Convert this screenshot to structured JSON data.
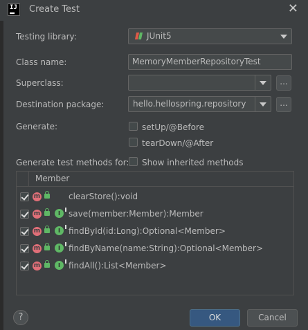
{
  "window": {
    "title": "Create Test",
    "app_icon_text": "IJ"
  },
  "form": {
    "testing_library": {
      "label": "Testing library:",
      "value": "JUnit5",
      "icon": "junit-icon"
    },
    "class_name": {
      "label": "Class name:",
      "value": "MemoryMemberRepositoryTest"
    },
    "superclass": {
      "label": "Superclass:",
      "value": ""
    },
    "destination_package": {
      "label": "Destination package:",
      "value": "hello.hellospring.repository"
    },
    "browse_label": "...",
    "generate": {
      "label": "Generate:",
      "options": [
        {
          "label": "setUp/@Before",
          "checked": false
        },
        {
          "label": "tearDown/@After",
          "checked": false
        }
      ]
    },
    "methods_for": {
      "label": "Generate test methods for:",
      "show_inherited_label": "Show inherited methods",
      "show_inherited_checked": false
    }
  },
  "members_table": {
    "header": "Member",
    "rows": [
      {
        "name": "clearStore():void",
        "checked": true,
        "implements": false
      },
      {
        "name": "save(member:Member):Member",
        "checked": true,
        "implements": true
      },
      {
        "name": "findById(id:Long):Optional<Member>",
        "checked": true,
        "implements": true
      },
      {
        "name": "findByName(name:String):Optional<Member>",
        "checked": true,
        "implements": true
      },
      {
        "name": "findAll():List<Member>",
        "checked": true,
        "implements": true
      }
    ],
    "method_badge": "m",
    "implements_badge": "I"
  },
  "footer": {
    "help_label": "?",
    "ok_label": "OK",
    "cancel_label": "Cancel"
  },
  "colors": {
    "background": "#3c3f41",
    "ok_button": "#365880",
    "method_icon": "#e06f78",
    "access_icon": "#5fb865"
  }
}
